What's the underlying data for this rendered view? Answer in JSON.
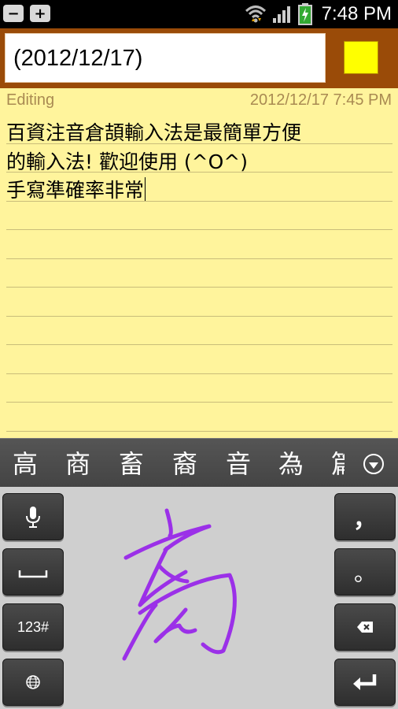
{
  "status_bar": {
    "time": "7:48 PM",
    "left_icons": [
      "minus-icon",
      "plus-icon"
    ],
    "right_icons": [
      "wifi-icon",
      "signal-icon",
      "battery-charging-icon"
    ]
  },
  "title_bar": {
    "title_value": "(2012/12/17)",
    "note_color": "#ffff00"
  },
  "note": {
    "status": "Editing",
    "timestamp": "2012/12/17 7:45 PM",
    "lines": [
      "百資注音倉頡輸入法是最簡單方便",
      "的輸入法! 歡迎使用 (^O^)",
      "手寫準確率非常"
    ]
  },
  "candidates": {
    "items": [
      "高",
      "商",
      "畜",
      "裔",
      "音",
      "為",
      "篇"
    ],
    "expand_icon": "chevron-down-circle-icon"
  },
  "keyboard": {
    "left_keys": [
      {
        "name": "microphone-icon"
      },
      {
        "name": "space-icon"
      },
      {
        "label": "123#"
      },
      {
        "name": "globe-icon"
      }
    ],
    "right_keys": [
      {
        "label": "，"
      },
      {
        "label": "。"
      },
      {
        "name": "backspace-icon"
      },
      {
        "name": "enter-icon"
      }
    ],
    "handwriting_color": "#9b30e8"
  }
}
